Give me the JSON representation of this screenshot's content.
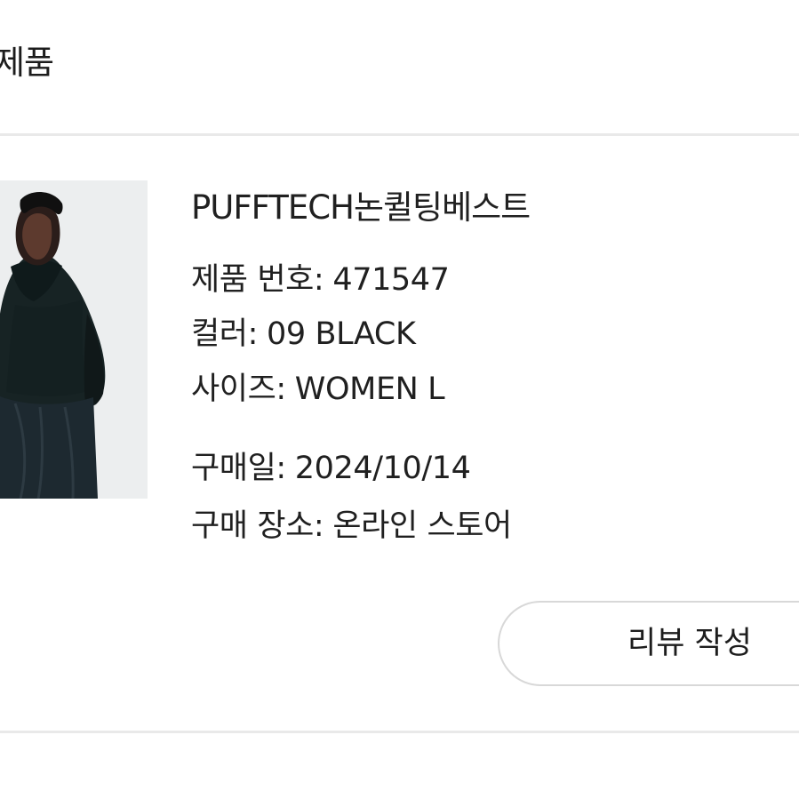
{
  "section": {
    "title": "제품"
  },
  "product": {
    "name": "PUFFTECH논퀼팅베스트",
    "number_label": "제품 번호:",
    "number_value": "471547",
    "color_label": "컬러:",
    "color_value": "09 BLACK",
    "size_label": "사이즈:",
    "size_value": "WOMEN L",
    "purchase_date_label": "구매일:",
    "purchase_date_value": "2024/10/14",
    "purchase_place_label": "구매 장소:",
    "purchase_place_value": "온라인 스토어"
  },
  "actions": {
    "review_label": "리뷰 작성"
  },
  "colors": {
    "divider": "#e9e9e9",
    "button_border": "#d8d8d8",
    "text": "#202020"
  }
}
